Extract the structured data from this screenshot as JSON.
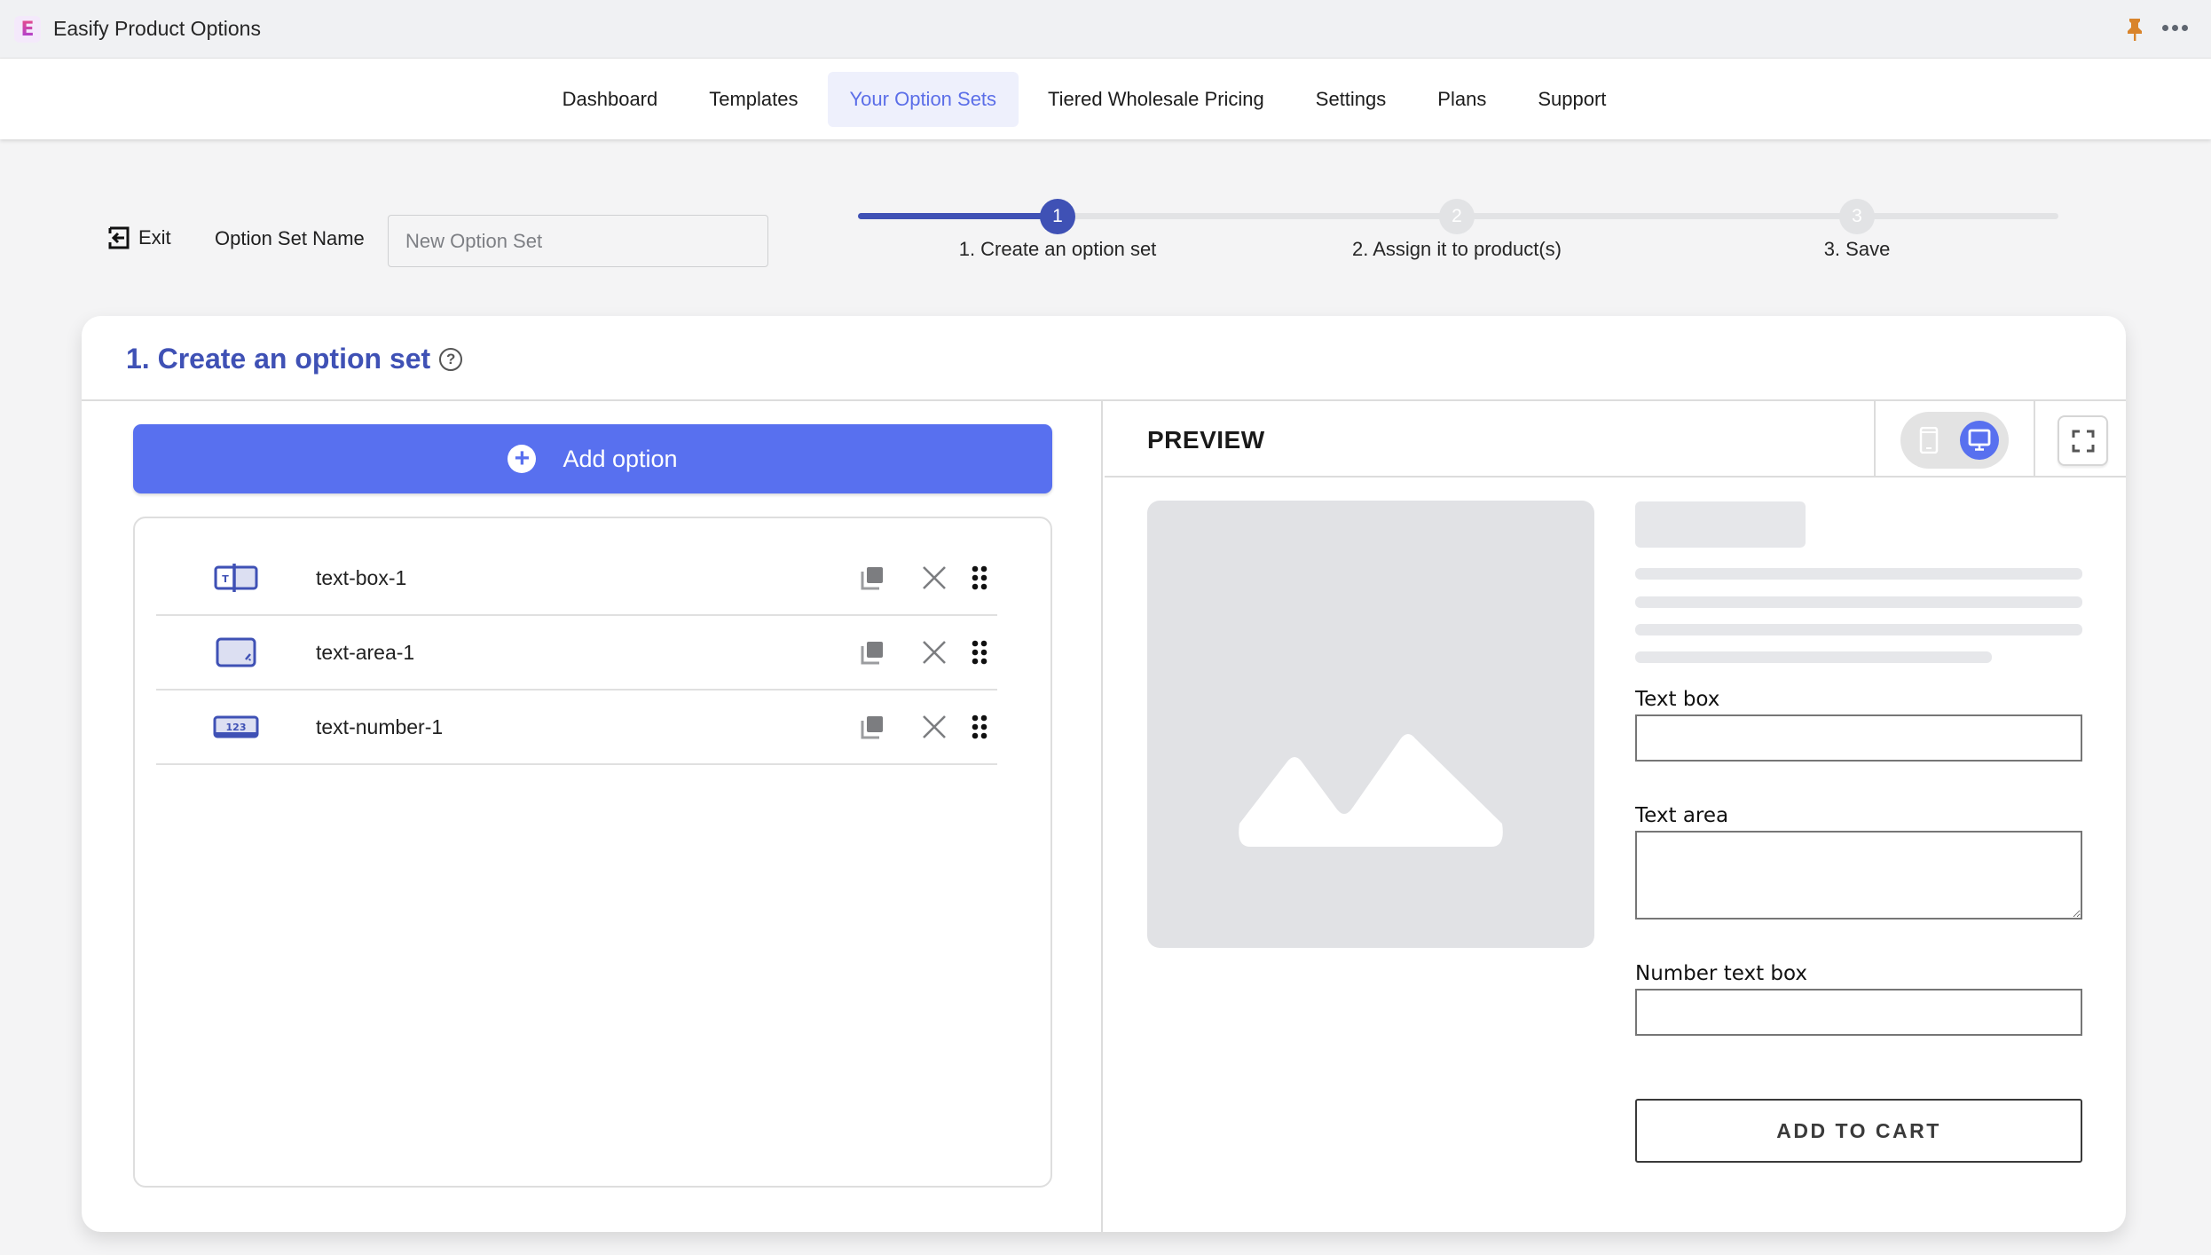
{
  "app": {
    "title": "Easify Product Options",
    "logo_glyph": "E",
    "icons": {
      "pin": "pin-icon",
      "more": "more-horizontal-icon"
    },
    "pin_color": "#d9842b"
  },
  "nav": {
    "items": [
      {
        "label": "Dashboard",
        "active": false
      },
      {
        "label": "Templates",
        "active": false
      },
      {
        "label": "Your Option Sets",
        "active": true
      },
      {
        "label": "Tiered Wholesale Pricing",
        "active": false
      },
      {
        "label": "Settings",
        "active": false
      },
      {
        "label": "Plans",
        "active": false
      },
      {
        "label": "Support",
        "active": false
      }
    ],
    "active_color": "#5b6ee8"
  },
  "toolbar": {
    "exit_label": "Exit",
    "option_set_name_label": "Option Set Name",
    "option_set_name_value": "",
    "option_set_name_placeholder": "New Option Set"
  },
  "stepper": {
    "current_step": 1,
    "progress_fraction": 0.167,
    "steps": [
      {
        "number": "1",
        "label": "1. Create an option set"
      },
      {
        "number": "2",
        "label": "2. Assign it to product(s)"
      },
      {
        "number": "3",
        "label": "3. Save"
      }
    ],
    "accent_color": "#3f51b5"
  },
  "card": {
    "title": "1. Create an option set",
    "help_glyph": "?",
    "add_option_label": "Add option",
    "options": [
      {
        "name": "text-box-1",
        "type_icon": "text-box-icon"
      },
      {
        "name": "text-area-1",
        "type_icon": "text-area-icon"
      },
      {
        "name": "text-number-1",
        "type_icon": "number-box-icon",
        "icon_text": "123"
      }
    ],
    "button_color": "#5870ef"
  },
  "preview": {
    "title": "PREVIEW",
    "device_mode": "desktop",
    "fields": [
      {
        "label": "Text box",
        "kind": "text",
        "value": ""
      },
      {
        "label": "Text area",
        "kind": "textarea",
        "value": ""
      },
      {
        "label": "Number text box",
        "kind": "number",
        "value": ""
      }
    ],
    "add_to_cart_label": "ADD TO CART"
  }
}
